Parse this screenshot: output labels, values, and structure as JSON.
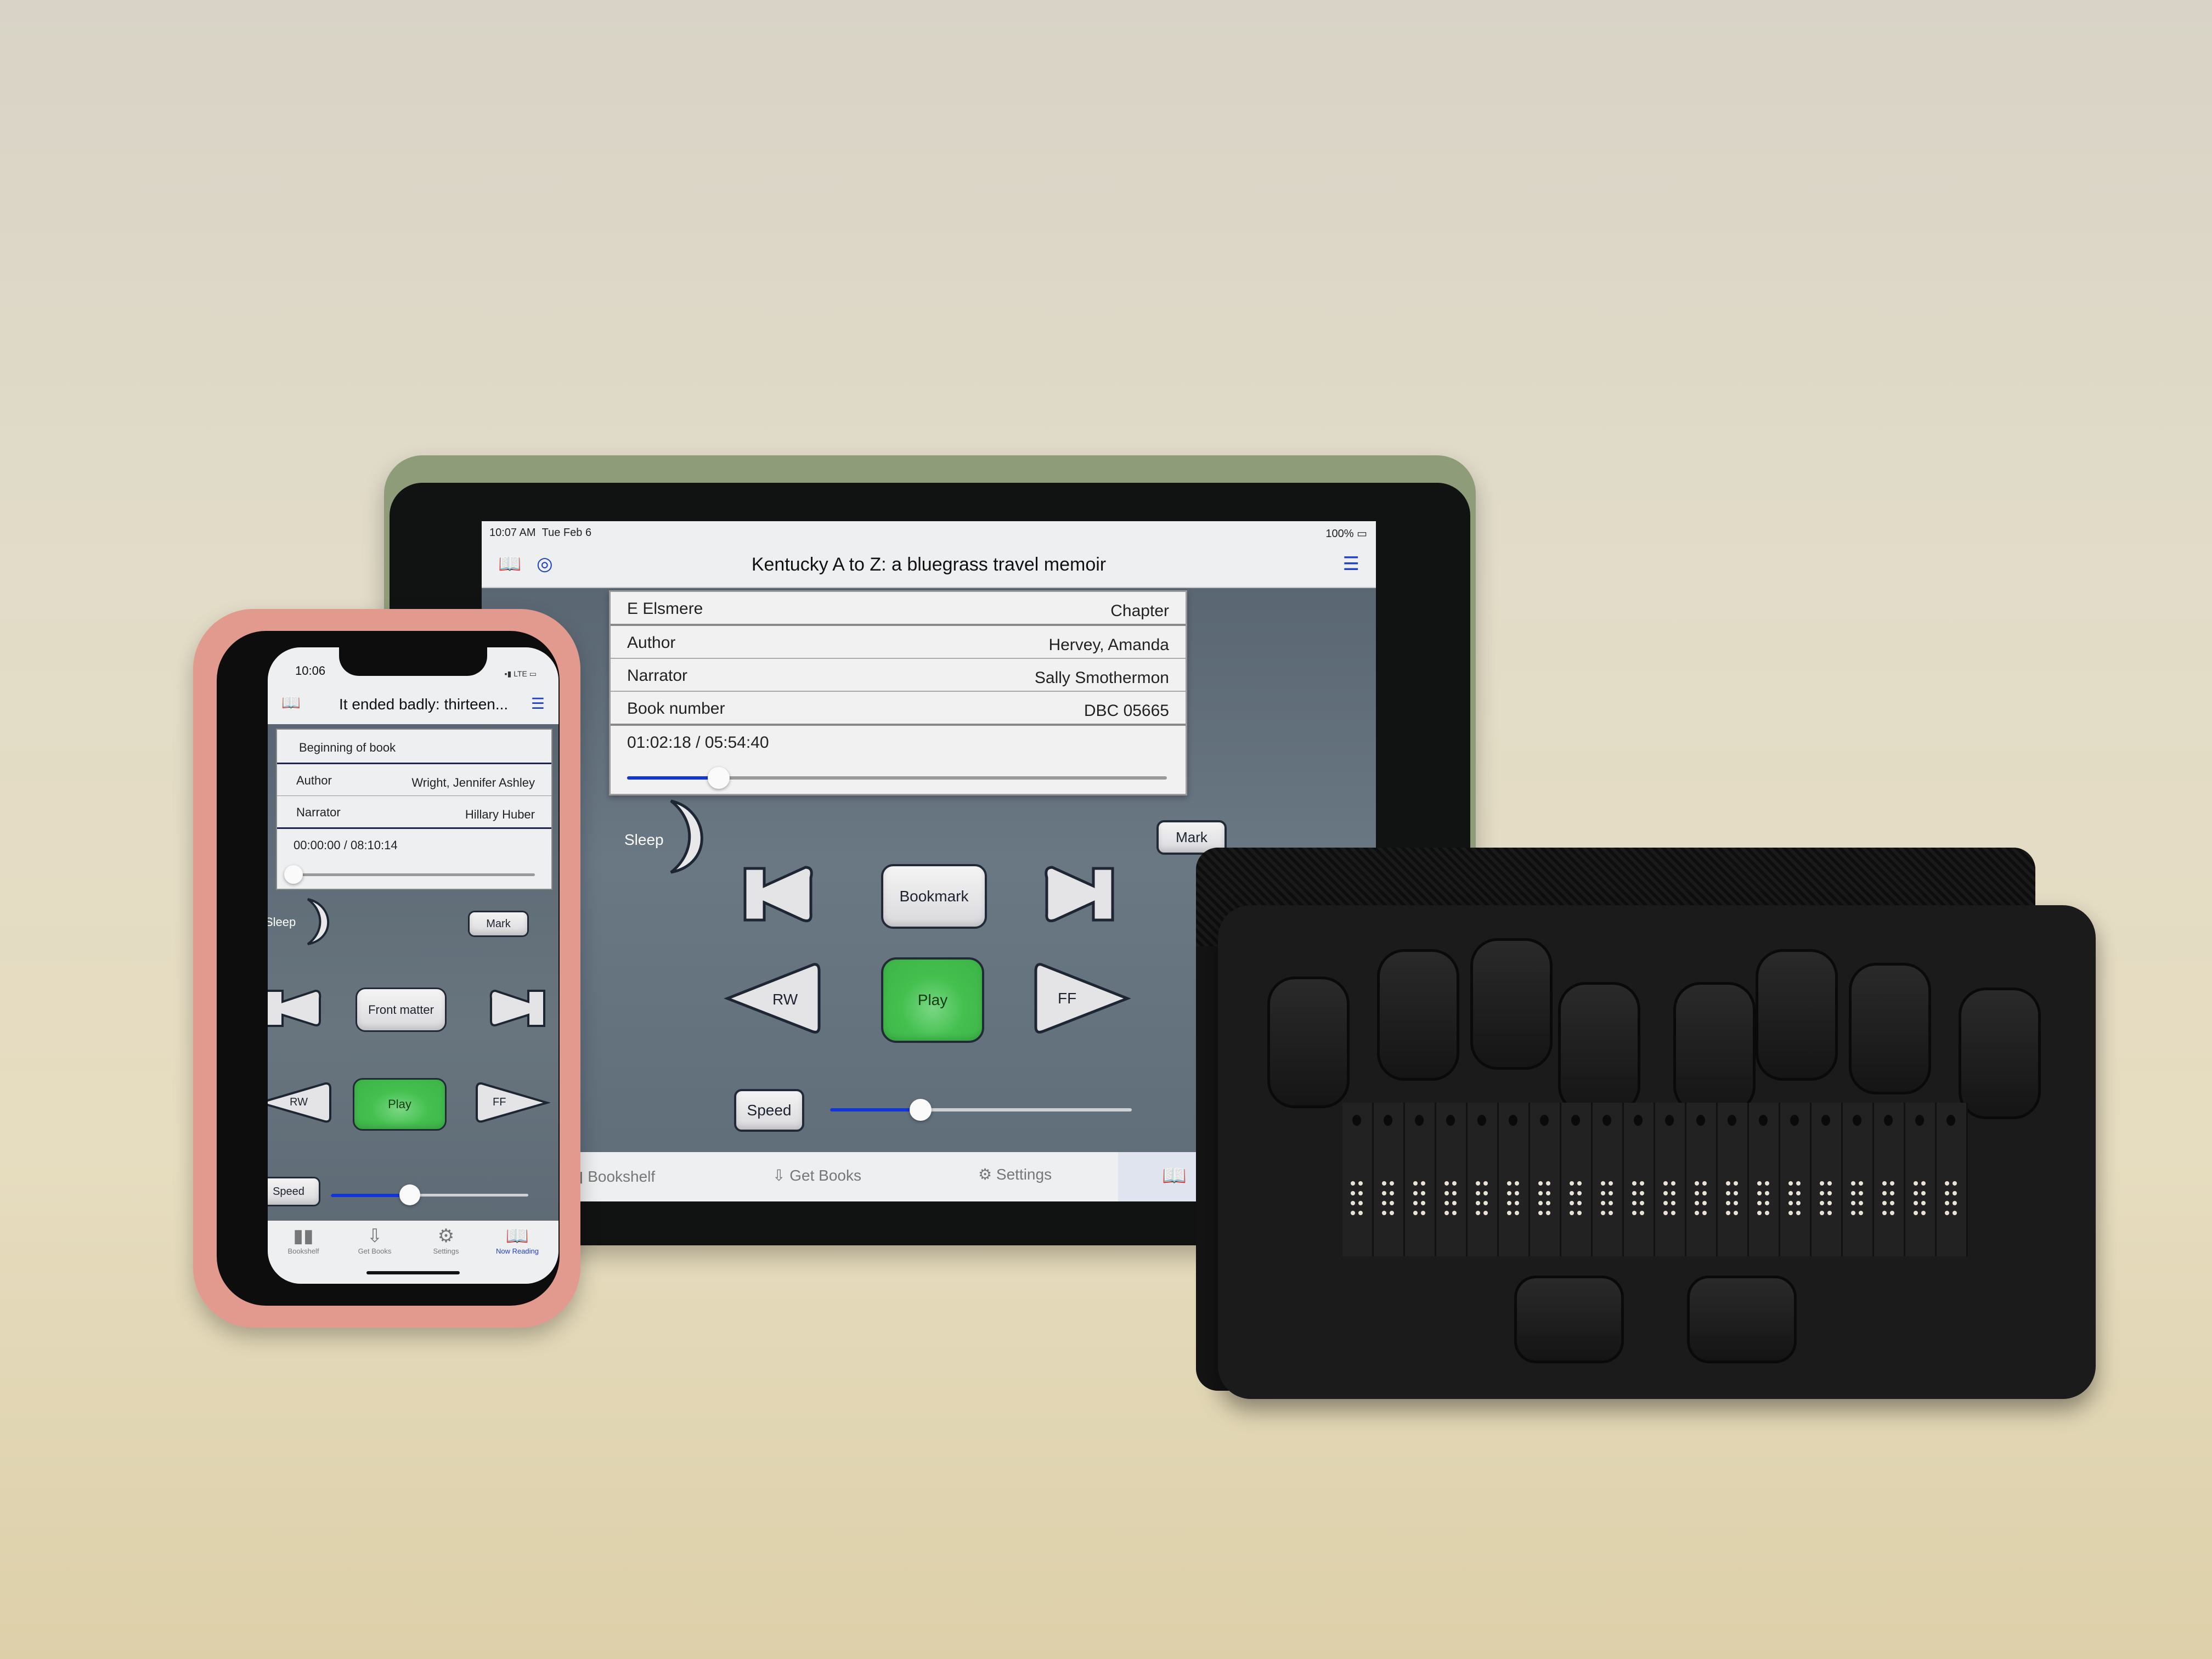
{
  "ipad": {
    "status": {
      "time": "10:07 AM",
      "date": "Tue Feb 6",
      "battery": "100%"
    },
    "nav": {
      "title": "Kentucky A to Z: a bluegrass travel memoir",
      "left_icons": [
        "bookshelf-icon",
        "airplay-icon"
      ],
      "right_icon": "list-icon"
    },
    "info": {
      "position": {
        "label": "E Elsmere",
        "value": "Chapter"
      },
      "rows": [
        {
          "label": "Author",
          "value": "Hervey, Amanda"
        },
        {
          "label": "Narrator",
          "value": "Sally Smothermon"
        },
        {
          "label": "Book number",
          "value": "DBC 05665"
        }
      ],
      "time": "01:02:18 / 05:54:40",
      "progress_percent": 17
    },
    "controls": {
      "sleep": "Sleep",
      "mark": "Mark",
      "bookmark": "Bookmark",
      "rw": "RW",
      "play": "Play",
      "ff": "FF",
      "speed": "Speed",
      "speed_percent": 30
    },
    "tabs": [
      {
        "label": "Bookshelf",
        "icon": "bookshelf-icon",
        "active": false
      },
      {
        "label": "Get Books",
        "icon": "download-icon",
        "active": false
      },
      {
        "label": "Settings",
        "icon": "gear-icon",
        "active": false
      },
      {
        "label": "",
        "icon": "now-reading-icon",
        "active": true
      }
    ]
  },
  "iphone": {
    "status": {
      "time": "10:06",
      "network": "LTE"
    },
    "nav": {
      "title": "It ended badly: thirteen...",
      "left_icon": "bookshelf-icon",
      "right_icon": "list-icon"
    },
    "info": {
      "position": "Beginning of book",
      "rows": [
        {
          "label": "Author",
          "value": "Wright, Jennifer Ashley"
        },
        {
          "label": "Narrator",
          "value": "Hillary Huber"
        }
      ],
      "time": "00:00:00 / 08:10:14",
      "progress_percent": 0
    },
    "controls": {
      "sleep": "Sleep",
      "mark": "Mark",
      "front_matter": "Front matter",
      "rw": "RW",
      "play": "Play",
      "ff": "FF",
      "speed": "Speed",
      "speed_percent": 40
    },
    "tabs": [
      {
        "label": "Bookshelf",
        "icon": "bookshelf-icon",
        "active": false
      },
      {
        "label": "Get Books",
        "icon": "download-icon",
        "active": false
      },
      {
        "label": "Settings",
        "icon": "gear-icon",
        "active": false
      },
      {
        "label": "Now Reading",
        "icon": "now-reading-icon",
        "active": true
      }
    ]
  },
  "braille_display": {
    "cells": 20,
    "keys": 8,
    "thumb_keys": 2
  },
  "colors": {
    "accent_blue": "#1e3fc8",
    "play_green": "#44c04f",
    "screen_bg": "#5f6d79"
  }
}
